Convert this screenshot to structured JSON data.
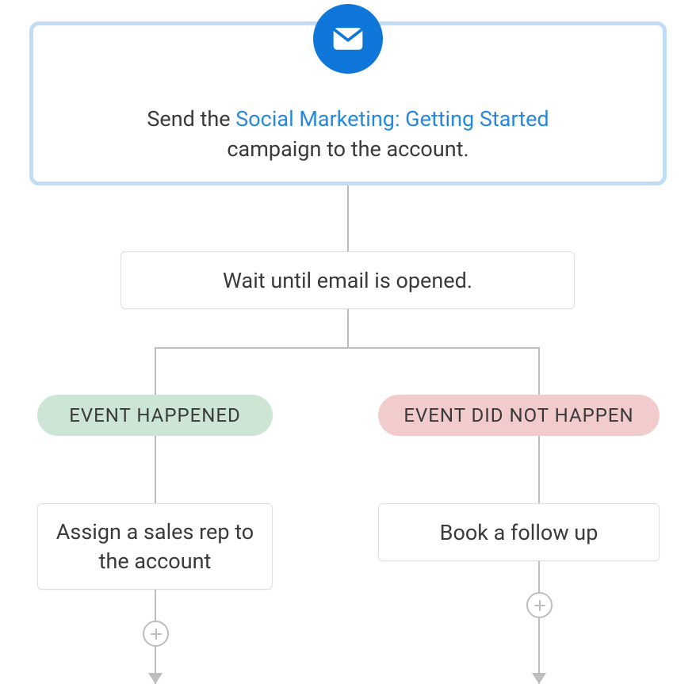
{
  "topCard": {
    "textBefore": "Send the ",
    "linkText": "Social Marketing: Getting Started",
    "textAfter": " campaign to the account."
  },
  "waitCard": {
    "text": "Wait until email is opened."
  },
  "branches": {
    "left": {
      "pillLabel": "EVENT HAPPENED",
      "actionText": "Assign a sales rep to the account"
    },
    "right": {
      "pillLabel": "EVENT DID NOT HAPPEN",
      "actionText": "Book a follow up"
    }
  },
  "icons": {
    "envelope": "envelope-icon",
    "addStep": "plus-icon"
  }
}
